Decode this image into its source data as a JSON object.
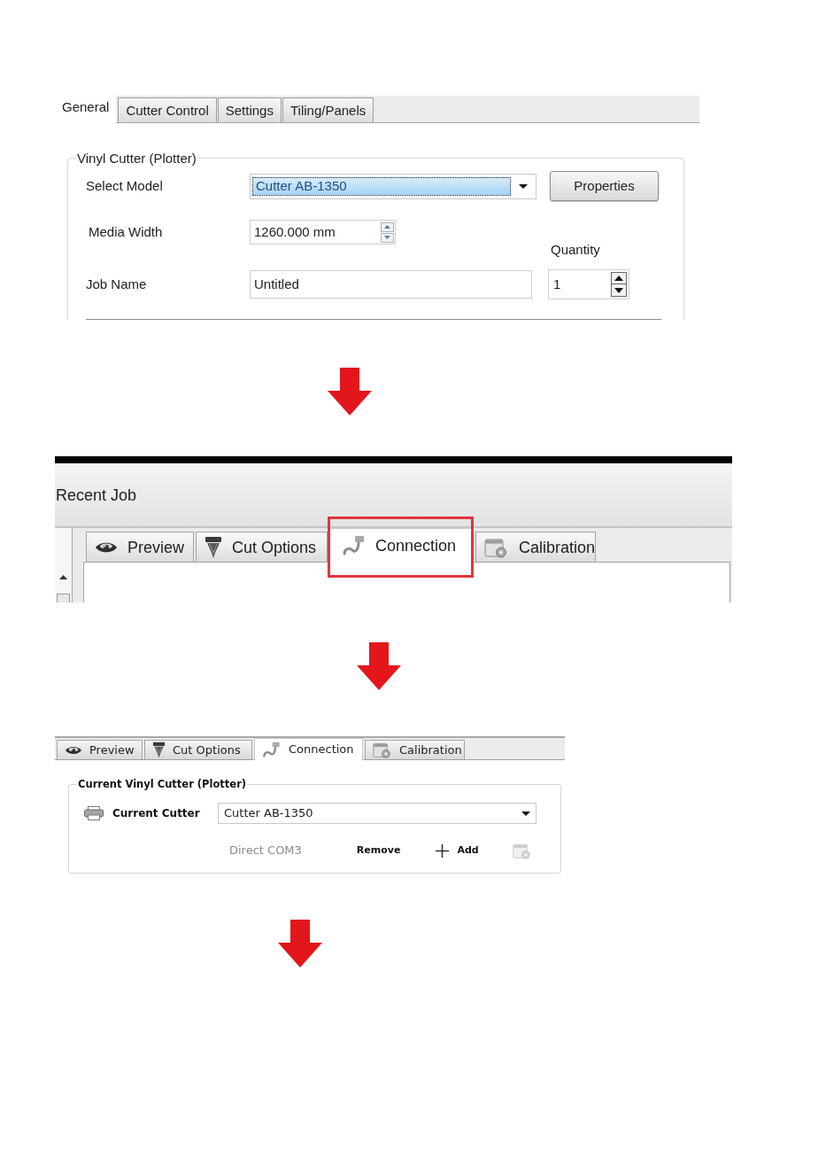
{
  "step_1": {
    "tabs": [
      {
        "label": "General",
        "selected": true
      },
      {
        "label": "Cutter Control",
        "selected": false
      },
      {
        "label": "Settings",
        "selected": false
      },
      {
        "label": "Tiling/Panels",
        "selected": false
      }
    ],
    "group": {
      "title": "Vinyl Cutter (Plotter)",
      "select_model": {
        "label": "Select Model",
        "value": "Cutter AB-1350",
        "focused": true
      },
      "properties_button": "Properties",
      "media_width": {
        "label": "Media Width",
        "value": "1260.000 mm"
      },
      "quantity": {
        "label": "Quantity",
        "value": "1"
      },
      "job_name": {
        "label": "Job Name",
        "value": "Untitled"
      }
    }
  },
  "step_2": {
    "header": "Recent Job",
    "tabs": [
      {
        "label": "Preview",
        "kind": "preview",
        "selected": false,
        "highlighted": false
      },
      {
        "label": "Cut Options",
        "kind": "cut",
        "selected": false,
        "highlighted": false
      },
      {
        "label": "Connection",
        "kind": "connection",
        "selected": true,
        "highlighted": true
      },
      {
        "label": "Calibration",
        "kind": "calibration",
        "selected": false,
        "highlighted": false
      }
    ]
  },
  "step_3": {
    "tabs": [
      {
        "label": "Preview",
        "kind": "preview",
        "selected": false
      },
      {
        "label": "Cut Options",
        "kind": "cut",
        "selected": false
      },
      {
        "label": "Connection",
        "kind": "connection",
        "selected": true
      },
      {
        "label": "Calibration",
        "kind": "calibration",
        "selected": false
      }
    ],
    "group": {
      "title": "Current Vinyl Cutter (Plotter)",
      "current_cutter": {
        "label": "Current Cutter",
        "value": "Cutter AB-1350"
      },
      "connection": "Direct COM3",
      "remove_button": "Remove",
      "add_button": "Add"
    }
  }
}
